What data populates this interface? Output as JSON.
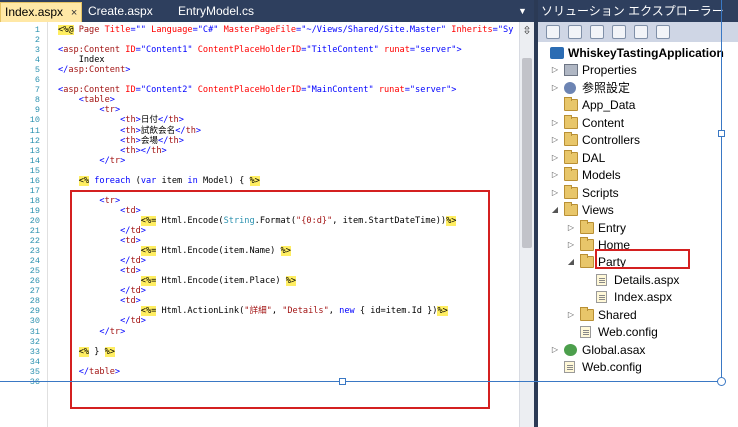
{
  "editor": {
    "tabs": [
      {
        "label": "Index.aspx",
        "active": true,
        "close": "×"
      },
      {
        "label": "Create.aspx",
        "active": false
      },
      {
        "label": "EntryModel.cs",
        "active": false
      }
    ],
    "overflow_glyph": "▼",
    "split_glyph": "⇳",
    "lines": [
      {
        "n": "1",
        "spans": [
          [
            "<%@",
            "hl"
          ],
          [
            " Page ",
            "c-maroon"
          ],
          [
            "Title",
            "c-red"
          ],
          [
            "=\"\" ",
            "c-blue"
          ],
          [
            "Language",
            "c-red"
          ],
          [
            "=\"C#\" ",
            "c-blue"
          ],
          [
            "MasterPageFile",
            "c-red"
          ],
          [
            "=\"~/Views/Shared/Site.Master\" ",
            "c-blue"
          ],
          [
            "Inherits",
            "c-red"
          ],
          [
            "=\"Sy",
            "c-blue"
          ]
        ]
      },
      {
        "n": "2",
        "spans": []
      },
      {
        "n": "3",
        "spans": [
          [
            "<",
            "c-blue"
          ],
          [
            "asp:Content",
            "c-tag"
          ],
          [
            " ID",
            "c-red"
          ],
          [
            "=\"Content1\" ",
            "c-blue"
          ],
          [
            "ContentPlaceHolderID",
            "c-red"
          ],
          [
            "=\"TitleContent\" ",
            "c-blue"
          ],
          [
            "runat",
            "c-red"
          ],
          [
            "=\"server\">",
            "c-blue"
          ]
        ]
      },
      {
        "n": "4",
        "spans": [
          [
            "    Index",
            ""
          ]
        ]
      },
      {
        "n": "5",
        "spans": [
          [
            "</",
            "c-blue"
          ],
          [
            "asp:Content",
            "c-tag"
          ],
          [
            ">",
            "c-blue"
          ]
        ]
      },
      {
        "n": "6",
        "spans": []
      },
      {
        "n": "7",
        "spans": [
          [
            "<",
            "c-blue"
          ],
          [
            "asp:Content",
            "c-tag"
          ],
          [
            " ID",
            "c-red"
          ],
          [
            "=\"Content2\" ",
            "c-blue"
          ],
          [
            "ContentPlaceHolderID",
            "c-red"
          ],
          [
            "=\"MainContent\" ",
            "c-blue"
          ],
          [
            "runat",
            "c-red"
          ],
          [
            "=\"server\">",
            "c-blue"
          ]
        ]
      },
      {
        "n": "8",
        "spans": [
          [
            "    <",
            "c-blue"
          ],
          [
            "table",
            "c-tag"
          ],
          [
            ">",
            "c-blue"
          ]
        ]
      },
      {
        "n": "9",
        "spans": [
          [
            "        <",
            "c-blue"
          ],
          [
            "tr",
            "c-tag"
          ],
          [
            ">",
            "c-blue"
          ]
        ]
      },
      {
        "n": "10",
        "spans": [
          [
            "            <",
            "c-blue"
          ],
          [
            "th",
            "c-tag"
          ],
          [
            ">",
            "c-blue"
          ],
          [
            "日付",
            ""
          ],
          [
            "</",
            "c-blue"
          ],
          [
            "th",
            "c-tag"
          ],
          [
            ">",
            "c-blue"
          ]
        ]
      },
      {
        "n": "11",
        "spans": [
          [
            "            <",
            "c-blue"
          ],
          [
            "th",
            "c-tag"
          ],
          [
            ">",
            "c-blue"
          ],
          [
            "試飲会名",
            ""
          ],
          [
            "</",
            "c-blue"
          ],
          [
            "th",
            "c-tag"
          ],
          [
            ">",
            "c-blue"
          ]
        ]
      },
      {
        "n": "12",
        "spans": [
          [
            "            <",
            "c-blue"
          ],
          [
            "th",
            "c-tag"
          ],
          [
            ">",
            "c-blue"
          ],
          [
            "会場",
            ""
          ],
          [
            "</",
            "c-blue"
          ],
          [
            "th",
            "c-tag"
          ],
          [
            ">",
            "c-blue"
          ]
        ]
      },
      {
        "n": "13",
        "spans": [
          [
            "            <",
            "c-blue"
          ],
          [
            "th",
            "c-tag"
          ],
          [
            "></",
            "c-blue"
          ],
          [
            "th",
            "c-tag"
          ],
          [
            ">",
            "c-blue"
          ]
        ]
      },
      {
        "n": "14",
        "spans": [
          [
            "        </",
            "c-blue"
          ],
          [
            "tr",
            "c-tag"
          ],
          [
            ">",
            "c-blue"
          ]
        ]
      },
      {
        "n": "15",
        "spans": []
      },
      {
        "n": "16",
        "spans": [
          [
            "    ",
            ""
          ],
          [
            "<%",
            "hl"
          ],
          [
            " ",
            ""
          ],
          [
            "foreach",
            "c-blue"
          ],
          [
            " (",
            ""
          ],
          [
            "var",
            "c-blue"
          ],
          [
            " item ",
            ""
          ],
          [
            "in",
            "c-blue"
          ],
          [
            " Model) { ",
            ""
          ],
          [
            "%>",
            "hl"
          ]
        ]
      },
      {
        "n": "17",
        "spans": []
      },
      {
        "n": "18",
        "spans": [
          [
            "        <",
            "c-blue"
          ],
          [
            "tr",
            "c-tag"
          ],
          [
            ">",
            "c-blue"
          ]
        ]
      },
      {
        "n": "19",
        "spans": [
          [
            "            <",
            "c-blue"
          ],
          [
            "td",
            "c-tag"
          ],
          [
            ">",
            "c-blue"
          ]
        ]
      },
      {
        "n": "20",
        "spans": [
          [
            "                ",
            ""
          ],
          [
            "<%=",
            "hl"
          ],
          [
            " Html.Encode(",
            ""
          ],
          [
            "String",
            "c-teal"
          ],
          [
            ".Format(",
            ""
          ],
          [
            "\"{0:d}\"",
            "c-maroon"
          ],
          [
            ", item.StartDateTime))",
            ""
          ],
          [
            "%>",
            "hl"
          ]
        ]
      },
      {
        "n": "21",
        "spans": [
          [
            "            </",
            "c-blue"
          ],
          [
            "td",
            "c-tag"
          ],
          [
            ">",
            "c-blue"
          ]
        ]
      },
      {
        "n": "22",
        "spans": [
          [
            "            <",
            "c-blue"
          ],
          [
            "td",
            "c-tag"
          ],
          [
            ">",
            "c-blue"
          ]
        ]
      },
      {
        "n": "23",
        "spans": [
          [
            "                ",
            ""
          ],
          [
            "<%=",
            "hl"
          ],
          [
            " Html.Encode(item.Name) ",
            ""
          ],
          [
            "%>",
            "hl"
          ]
        ]
      },
      {
        "n": "24",
        "spans": [
          [
            "            </",
            "c-blue"
          ],
          [
            "td",
            "c-tag"
          ],
          [
            ">",
            "c-blue"
          ]
        ]
      },
      {
        "n": "25",
        "spans": [
          [
            "            <",
            "c-blue"
          ],
          [
            "td",
            "c-tag"
          ],
          [
            ">",
            "c-blue"
          ]
        ]
      },
      {
        "n": "26",
        "spans": [
          [
            "                ",
            ""
          ],
          [
            "<%=",
            "hl"
          ],
          [
            " Html.Encode(item.Place) ",
            ""
          ],
          [
            "%>",
            "hl"
          ]
        ]
      },
      {
        "n": "27",
        "spans": [
          [
            "            </",
            "c-blue"
          ],
          [
            "td",
            "c-tag"
          ],
          [
            ">",
            "c-blue"
          ]
        ]
      },
      {
        "n": "28",
        "spans": [
          [
            "            <",
            "c-blue"
          ],
          [
            "td",
            "c-tag"
          ],
          [
            ">",
            "c-blue"
          ]
        ]
      },
      {
        "n": "29",
        "spans": [
          [
            "                ",
            ""
          ],
          [
            "<%=",
            "hl"
          ],
          [
            " Html.ActionLink(",
            ""
          ],
          [
            "\"詳細\"",
            "c-maroon"
          ],
          [
            ", ",
            ""
          ],
          [
            "\"Details\"",
            "c-maroon"
          ],
          [
            ", ",
            ""
          ],
          [
            "new",
            "c-blue"
          ],
          [
            " { id=item.Id })",
            ""
          ],
          [
            "%>",
            "hl"
          ]
        ]
      },
      {
        "n": "30",
        "spans": [
          [
            "            </",
            "c-blue"
          ],
          [
            "td",
            "c-tag"
          ],
          [
            ">",
            "c-blue"
          ]
        ]
      },
      {
        "n": "31",
        "spans": [
          [
            "        </",
            "c-blue"
          ],
          [
            "tr",
            "c-tag"
          ],
          [
            ">",
            "c-blue"
          ]
        ]
      },
      {
        "n": "32",
        "spans": []
      },
      {
        "n": "33",
        "spans": [
          [
            "    ",
            ""
          ],
          [
            "<%",
            "hl"
          ],
          [
            " } ",
            ""
          ],
          [
            "%>",
            "hl"
          ]
        ]
      },
      {
        "n": "34",
        "spans": []
      },
      {
        "n": "35",
        "spans": [
          [
            "    </",
            "c-blue"
          ],
          [
            "table",
            "c-tag"
          ],
          [
            ">",
            "c-blue"
          ]
        ]
      },
      {
        "n": "36",
        "spans": []
      }
    ]
  },
  "solution_explorer": {
    "title": "ソリューション エクスプローラー",
    "toolbar_buttons": [
      "properties-icon",
      "show-all-files-icon",
      "refresh-icon",
      "view-code-icon",
      "view-designer-icon",
      "class-diagram-icon"
    ],
    "tree": [
      {
        "label": "WhiskeyTastingApplication",
        "depth": 0,
        "arrow": "",
        "icon": "proj",
        "bold": true
      },
      {
        "label": "Properties",
        "depth": 1,
        "arrow": "▷",
        "icon": "wrench"
      },
      {
        "label": "参照設定",
        "depth": 1,
        "arrow": "▷",
        "icon": "gear"
      },
      {
        "label": "App_Data",
        "depth": 1,
        "arrow": "",
        "icon": "folder"
      },
      {
        "label": "Content",
        "depth": 1,
        "arrow": "▷",
        "icon": "folder"
      },
      {
        "label": "Controllers",
        "depth": 1,
        "arrow": "▷",
        "icon": "folder"
      },
      {
        "label": "DAL",
        "depth": 1,
        "arrow": "▷",
        "icon": "folder"
      },
      {
        "label": "Models",
        "depth": 1,
        "arrow": "▷",
        "icon": "folder"
      },
      {
        "label": "Scripts",
        "depth": 1,
        "arrow": "▷",
        "icon": "folder"
      },
      {
        "label": "Views",
        "depth": 1,
        "arrow": "◢",
        "icon": "folder"
      },
      {
        "label": "Entry",
        "depth": 2,
        "arrow": "▷",
        "icon": "folder"
      },
      {
        "label": "Home",
        "depth": 2,
        "arrow": "▷",
        "icon": "folder"
      },
      {
        "label": "Party",
        "depth": 2,
        "arrow": "◢",
        "icon": "folder"
      },
      {
        "label": "Details.aspx",
        "depth": 3,
        "arrow": "",
        "icon": "file"
      },
      {
        "label": "Index.aspx",
        "depth": 3,
        "arrow": "",
        "icon": "file",
        "selected": true
      },
      {
        "label": "Shared",
        "depth": 2,
        "arrow": "▷",
        "icon": "folder"
      },
      {
        "label": "Web.config",
        "depth": 2,
        "arrow": "",
        "icon": "file"
      },
      {
        "label": "Global.asax",
        "depth": 1,
        "arrow": "▷",
        "icon": "globe"
      },
      {
        "label": "Web.config",
        "depth": 1,
        "arrow": "",
        "icon": "file"
      }
    ]
  },
  "colors": {
    "chrome_dark": "#2e3f5e",
    "active_tab": "#ffe8a6",
    "annotation_red": "#d42020",
    "selection_handles": "#3a78c4",
    "server_tag_highlight": "#ffee62"
  }
}
